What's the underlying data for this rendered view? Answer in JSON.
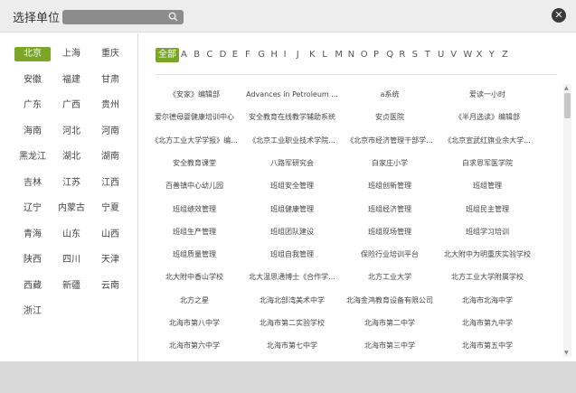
{
  "dialog": {
    "title": "选择单位",
    "search_placeholder": "",
    "close_glyph": "✕"
  },
  "provinces": [
    [
      "北京",
      "上海",
      "重庆"
    ],
    [
      "安徽",
      "福建",
      "甘肃"
    ],
    [
      "广东",
      "广西",
      "贵州"
    ],
    [
      "海南",
      "河北",
      "河南"
    ],
    [
      "黑龙江",
      "湖北",
      "湖南"
    ],
    [
      "吉林",
      "江苏",
      "江西"
    ],
    [
      "辽宁",
      "内蒙古",
      "宁夏"
    ],
    [
      "青海",
      "山东",
      "山西"
    ],
    [
      "陕西",
      "四川",
      "天津"
    ],
    [
      "西藏",
      "新疆",
      "云南"
    ],
    [
      "浙江"
    ]
  ],
  "active_province": "北京",
  "letters": [
    "全部",
    "A",
    "B",
    "C",
    "D",
    "E",
    "F",
    "G",
    "H",
    "I",
    "J",
    "K",
    "L",
    "M",
    "N",
    "O",
    "P",
    "Q",
    "R",
    "S",
    "T",
    "U",
    "V",
    "W",
    "X",
    "Y",
    "Z"
  ],
  "active_letter": "全部",
  "units": [
    [
      "《安家》编辑部",
      "Advances in Petroleum ...",
      "a系统",
      "爱读一小时"
    ],
    [
      "爱尔德母婴健康培训中心",
      "安全教育在线教学辅助系统",
      "安贞医院",
      "《半月选读》编辑部"
    ],
    [
      "《北方工业大学学报》编...",
      "《北京工业职业技术学院...",
      "《北京市经济管理干部学...",
      "《北京宣武红旗业余大学..."
    ],
    [
      "安全教育课堂",
      "八路军研究会",
      "白家庄小学",
      "白求恩军医学院"
    ],
    [
      "百善镇中心幼儿园",
      "班组安全管理",
      "班组创新管理",
      "班组管理"
    ],
    [
      "班组绩效管理",
      "班组健康管理",
      "班组经济管理",
      "班组民主管理"
    ],
    [
      "班组生产管理",
      "班组团队建设",
      "班组现场管理",
      "班组学习培训"
    ],
    [
      "班组质量管理",
      "班组自我管理",
      "保险行业培训平台",
      "北大附中为明重庆实验学校"
    ],
    [
      "北大附中香山学校",
      "北大温思通博士《合作学...",
      "北方工业大学",
      "北方工业大学附属学校"
    ],
    [
      "北方之星",
      "北海北部湾美术中学",
      "北海金鸿教育设备有限公司",
      "北海市北海中学"
    ],
    [
      "北海市第八中学",
      "北海市第二实验学校",
      "北海市第二中学",
      "北海市第九中学"
    ],
    [
      "北海市第六中学",
      "北海市第七中学",
      "北海市第三中学",
      "北海市第五中学"
    ]
  ],
  "colors": {
    "accent": "#7aa526",
    "header_bg": "#ededed",
    "search_bg": "#8c8c8c",
    "close_bg": "#3a3a3a"
  }
}
